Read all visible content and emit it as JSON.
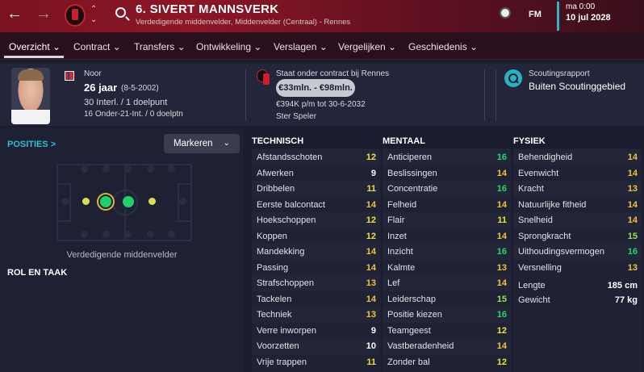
{
  "topbar": {
    "player_name": "6. SIVERT MANNSVERK",
    "player_sub": "Verdedigende middenvelder, Middenvelder (Centraal) - Rennes",
    "fm_label": "FM",
    "time": "ma 0:00",
    "date": "10 jul 2028"
  },
  "tabs": [
    "Overzicht ⌄",
    "Contract ⌄",
    "Transfers ⌄",
    "Ontwikkeling ⌄",
    "Verslagen ⌄",
    "Vergelijken ⌄",
    "Geschiedenis ⌄"
  ],
  "header": {
    "nationality": "Noor",
    "age": "26 jaar",
    "dob": "(8-5-2002)",
    "caps": "30 Interl. / 1 doelpunt",
    "u21": "16 Onder-21-Int. / 0 doelptn",
    "contract_status": "Staat onder contract bij Rennes",
    "value": "€33mln. - €98mln.",
    "wage": "€394K p/m tot 30-6-2032",
    "status": "Ster Speler",
    "scout_title": "Scoutingsrapport",
    "scout_value": "Buiten Scoutinggebied"
  },
  "left": {
    "posities": "POSITIES >",
    "markeren": "Markeren",
    "position_label": "Verdedigende middenvelder",
    "rol": "ROL EN TAAK"
  },
  "attributes": {
    "technisch_title": "TECHNISCH",
    "mentaal_title": "MENTAAL",
    "fysiek_title": "FYSIEK",
    "technisch": [
      {
        "name": "Afstandsschoten",
        "value": "12",
        "color": "yellow"
      },
      {
        "name": "Afwerken",
        "value": "9",
        "color": "white"
      },
      {
        "name": "Dribbelen",
        "value": "11",
        "color": "yellow"
      },
      {
        "name": "Eerste balcontact",
        "value": "14",
        "color": "orange"
      },
      {
        "name": "Hoekschoppen",
        "value": "12",
        "color": "yellow"
      },
      {
        "name": "Koppen",
        "value": "12",
        "color": "yellow"
      },
      {
        "name": "Mandekking",
        "value": "14",
        "color": "orange"
      },
      {
        "name": "Passing",
        "value": "14",
        "color": "orange"
      },
      {
        "name": "Strafschoppen",
        "value": "13",
        "color": "orange"
      },
      {
        "name": "Tackelen",
        "value": "14",
        "color": "orange"
      },
      {
        "name": "Techniek",
        "value": "13",
        "color": "orange"
      },
      {
        "name": "Verre inworpen",
        "value": "9",
        "color": "white"
      },
      {
        "name": "Voorzetten",
        "value": "10",
        "color": "white"
      },
      {
        "name": "Vrije trappen",
        "value": "11",
        "color": "yellow"
      }
    ],
    "mentaal": [
      {
        "name": "Anticiperen",
        "value": "16",
        "color": "green"
      },
      {
        "name": "Beslissingen",
        "value": "14",
        "color": "orange"
      },
      {
        "name": "Concentratie",
        "value": "16",
        "color": "green"
      },
      {
        "name": "Felheid",
        "value": "14",
        "color": "orange"
      },
      {
        "name": "Flair",
        "value": "11",
        "color": "yellow"
      },
      {
        "name": "Inzet",
        "value": "14",
        "color": "orange"
      },
      {
        "name": "Inzicht",
        "value": "16",
        "color": "green"
      },
      {
        "name": "Kalmte",
        "value": "13",
        "color": "orange"
      },
      {
        "name": "Lef",
        "value": "14",
        "color": "orange"
      },
      {
        "name": "Leiderschap",
        "value": "15",
        "color": "lgreen"
      },
      {
        "name": "Positie kiezen",
        "value": "16",
        "color": "green"
      },
      {
        "name": "Teamgeest",
        "value": "12",
        "color": "yellow"
      },
      {
        "name": "Vastberadenheid",
        "value": "14",
        "color": "orange"
      },
      {
        "name": "Zonder bal",
        "value": "12",
        "color": "yellow"
      }
    ],
    "fysiek": [
      {
        "name": "Behendigheid",
        "value": "14",
        "color": "orange"
      },
      {
        "name": "Evenwicht",
        "value": "14",
        "color": "orange"
      },
      {
        "name": "Kracht",
        "value": "13",
        "color": "orange"
      },
      {
        "name": "Natuurlijke fitheid",
        "value": "14",
        "color": "orange"
      },
      {
        "name": "Snelheid",
        "value": "14",
        "color": "orange"
      },
      {
        "name": "Sprongkracht",
        "value": "15",
        "color": "lgreen"
      },
      {
        "name": "Uithoudingsvermogen",
        "value": "16",
        "color": "green"
      },
      {
        "name": "Versnelling",
        "value": "13",
        "color": "orange"
      },
      {
        "name": "Lengte",
        "value": "185 cm",
        "color": "white"
      },
      {
        "name": "Gewicht",
        "value": "77 kg",
        "color": "white"
      }
    ]
  }
}
